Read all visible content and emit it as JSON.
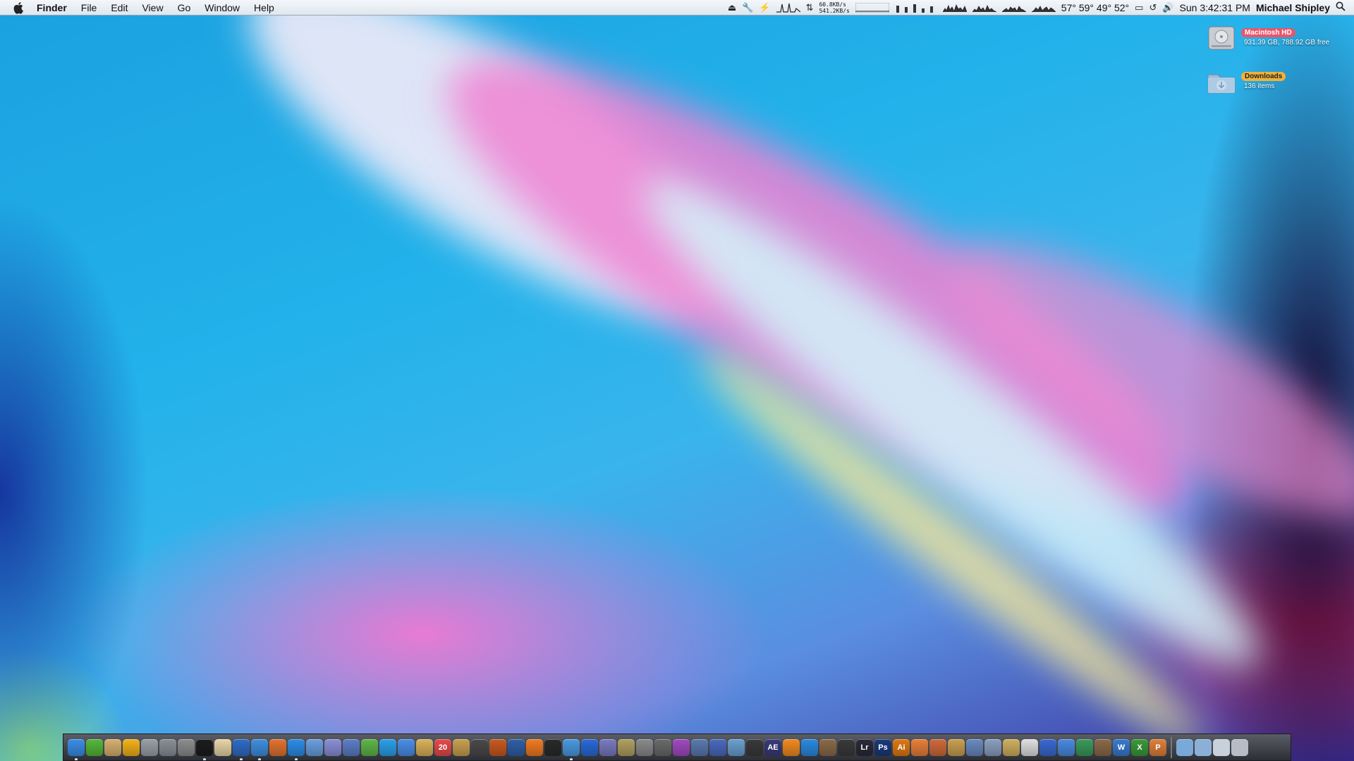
{
  "menubar": {
    "apple_icon": "apple-logo-icon",
    "app_name": "Finder",
    "menus": [
      "File",
      "Edit",
      "View",
      "Go",
      "Window",
      "Help"
    ],
    "network": {
      "upload": "60.8KB/s",
      "download": "541.2KB/s"
    },
    "temperatures": "57° 59° 49° 52°",
    "clock": "Sun 3:42:31 PM",
    "user": "Michael Shipley"
  },
  "desktop_icons": [
    {
      "label": "Macintosh HD",
      "sub": "931.39 GB, 788.92 GB free",
      "label_color": "#e8566a",
      "icon": "hard-drive-icon"
    },
    {
      "label": "Downloads",
      "sub": "136 items",
      "label_color": "#f0b23a",
      "icon": "downloads-folder-icon"
    }
  ],
  "dock": {
    "apps": [
      {
        "name": "finder",
        "color": "#3a8ee6",
        "running": true,
        "text": ""
      },
      {
        "name": "activity-monitor",
        "color": "#54b83a",
        "running": false,
        "text": ""
      },
      {
        "name": "preview",
        "color": "#d8b070",
        "running": false,
        "text": ""
      },
      {
        "name": "cyberduck",
        "color": "#f2b21a",
        "running": false,
        "text": ""
      },
      {
        "name": "disk-utility",
        "color": "#9aa0a8",
        "running": false,
        "text": ""
      },
      {
        "name": "system-preferences",
        "color": "#8a8f98",
        "running": false,
        "text": ""
      },
      {
        "name": "automator",
        "color": "#8d8d8d",
        "running": false,
        "text": ""
      },
      {
        "name": "terminal",
        "color": "#1c1c1c",
        "running": true,
        "text": ""
      },
      {
        "name": "text-edit",
        "color": "#e8d6a8",
        "running": false,
        "text": ""
      },
      {
        "name": "network-globe",
        "color": "#2f6cc8",
        "running": true,
        "text": ""
      },
      {
        "name": "safari",
        "color": "#3f8fe0",
        "running": true,
        "text": ""
      },
      {
        "name": "firefox",
        "color": "#e27330",
        "running": false,
        "text": ""
      },
      {
        "name": "app-store",
        "color": "#2d8de6",
        "running": true,
        "text": ""
      },
      {
        "name": "transmit",
        "color": "#6aa0e0",
        "running": false,
        "text": ""
      },
      {
        "name": "mail",
        "color": "#8a8fd8",
        "running": false,
        "text": ""
      },
      {
        "name": "photos",
        "color": "#5c7ec8",
        "running": false,
        "text": ""
      },
      {
        "name": "adium",
        "color": "#5fb64a",
        "running": false,
        "text": ""
      },
      {
        "name": "skype",
        "color": "#2aa0e8",
        "running": false,
        "text": ""
      },
      {
        "name": "messages",
        "color": "#4b8ee8",
        "running": false,
        "text": ""
      },
      {
        "name": "notes",
        "color": "#d9b25a",
        "running": false,
        "text": ""
      },
      {
        "name": "calendar",
        "color": "#e84a4a",
        "running": false,
        "text": "20"
      },
      {
        "name": "pencil-tool",
        "color": "#c8a050",
        "running": false,
        "text": ""
      },
      {
        "name": "preview-viewer",
        "color": "#4a4a4a",
        "running": false,
        "text": ""
      },
      {
        "name": "instruments",
        "color": "#c85a20",
        "running": false,
        "text": ""
      },
      {
        "name": "photo-booth",
        "color": "#3060a8",
        "running": false,
        "text": ""
      },
      {
        "name": "vlc-like",
        "color": "#f07a20",
        "running": false,
        "text": ""
      },
      {
        "name": "speaker",
        "color": "#2a2a2a",
        "running": false,
        "text": ""
      },
      {
        "name": "itunes",
        "color": "#4a9ae0",
        "running": true,
        "text": ""
      },
      {
        "name": "dvd-player",
        "color": "#2a6ad8",
        "running": false,
        "text": ""
      },
      {
        "name": "front-row",
        "color": "#7a7ac0",
        "running": false,
        "text": ""
      },
      {
        "name": "star-app",
        "color": "#b0a060",
        "running": false,
        "text": ""
      },
      {
        "name": "final-cut",
        "color": "#8a8a8a",
        "running": false,
        "text": ""
      },
      {
        "name": "film-reel",
        "color": "#6a6a6a",
        "running": false,
        "text": ""
      },
      {
        "name": "motion",
        "color": "#a04ac0",
        "running": false,
        "text": ""
      },
      {
        "name": "compressor",
        "color": "#5a7ab0",
        "running": false,
        "text": ""
      },
      {
        "name": "dvd-studio",
        "color": "#4a6ac0",
        "running": false,
        "text": ""
      },
      {
        "name": "soundtrack",
        "color": "#6aa0d0",
        "running": false,
        "text": ""
      },
      {
        "name": "clapper",
        "color": "#3a3a3a",
        "running": false,
        "text": ""
      },
      {
        "name": "after-effects",
        "color": "#3a3a7a",
        "running": false,
        "text": "AE"
      },
      {
        "name": "vlc",
        "color": "#f08a20",
        "running": false,
        "text": ""
      },
      {
        "name": "quicktime",
        "color": "#2a8ae0",
        "running": false,
        "text": ""
      },
      {
        "name": "image-capture",
        "color": "#8a6a4a",
        "running": false,
        "text": ""
      },
      {
        "name": "aperture",
        "color": "#3a3a3a",
        "running": false,
        "text": ""
      },
      {
        "name": "lightroom",
        "color": "#2a2a3a",
        "running": false,
        "text": "Lr"
      },
      {
        "name": "photoshop",
        "color": "#1a3a7a",
        "running": false,
        "text": "Ps"
      },
      {
        "name": "illustrator",
        "color": "#e07a10",
        "running": false,
        "text": "Ai"
      },
      {
        "name": "firefox-alt",
        "color": "#e8803a",
        "running": false,
        "text": ""
      },
      {
        "name": "script-editor",
        "color": "#d06a3a",
        "running": false,
        "text": ""
      },
      {
        "name": "text-wrangler",
        "color": "#c8a050",
        "running": false,
        "text": ""
      },
      {
        "name": "coda",
        "color": "#6a8ac0",
        "running": false,
        "text": ""
      },
      {
        "name": "bird-app",
        "color": "#8aa0c0",
        "running": false,
        "text": ""
      },
      {
        "name": "archive-utility",
        "color": "#d0b060",
        "running": false,
        "text": ""
      },
      {
        "name": "paper-app",
        "color": "#e0e0e0",
        "running": false,
        "text": ""
      },
      {
        "name": "xcode",
        "color": "#3a6ad0",
        "running": false,
        "text": ""
      },
      {
        "name": "brush-app",
        "color": "#4a8ae0",
        "running": false,
        "text": ""
      },
      {
        "name": "chart-app",
        "color": "#3a9a5a",
        "running": false,
        "text": ""
      },
      {
        "name": "dashcode",
        "color": "#8a6a4a",
        "running": false,
        "text": ""
      },
      {
        "name": "word",
        "color": "#3a7ad0",
        "running": false,
        "text": "W"
      },
      {
        "name": "excel",
        "color": "#3a9a3a",
        "running": false,
        "text": "X"
      },
      {
        "name": "powerpoint",
        "color": "#e0803a",
        "running": false,
        "text": "P"
      }
    ],
    "stacks": [
      {
        "name": "applications-folder",
        "color": "#7aa8d8"
      },
      {
        "name": "documents-folder",
        "color": "#8ab0d8"
      },
      {
        "name": "downloads-stack",
        "color": "#c8d0dc"
      },
      {
        "name": "trash",
        "color": "#b8bcc4"
      }
    ]
  }
}
